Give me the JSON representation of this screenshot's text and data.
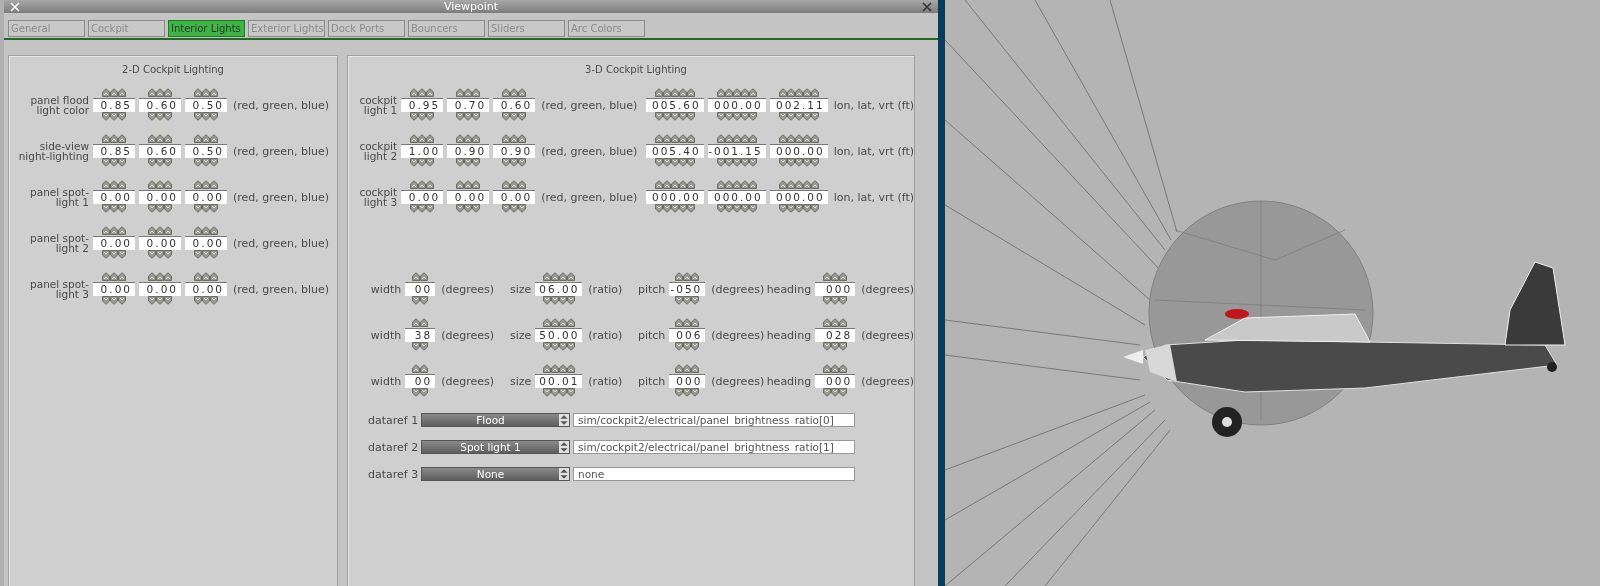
{
  "window": {
    "title": "Viewpoint"
  },
  "tabs": [
    {
      "label": "General",
      "selected": false
    },
    {
      "label": "Cockpit",
      "selected": false
    },
    {
      "label": "Interior Lights",
      "selected": true
    },
    {
      "label": "Exterior Lights",
      "selected": false
    },
    {
      "label": "Dock Ports",
      "selected": false
    },
    {
      "label": "Bouncers",
      "selected": false
    },
    {
      "label": "Sliders",
      "selected": false
    },
    {
      "label": "Arc Colors",
      "selected": false
    }
  ],
  "panel_2d": {
    "title": "2-D Cockpit Lighting",
    "rows": [
      {
        "label": "panel flood\nlight color",
        "values": [
          "0.85",
          "0.60",
          "0.50"
        ],
        "unit": "(red, green, blue)"
      },
      {
        "label": "side-view\nnight-lighting",
        "values": [
          "0.85",
          "0.60",
          "0.50"
        ],
        "unit": "(red, green, blue)"
      },
      {
        "label": "panel spot-\nlight 1",
        "values": [
          "0.00",
          "0.00",
          "0.00"
        ],
        "unit": "(red, green, blue)"
      },
      {
        "label": "panel spot-\nlight 2",
        "values": [
          "0.00",
          "0.00",
          "0.00"
        ],
        "unit": "(red, green, blue)"
      },
      {
        "label": "panel spot-\nlight 3",
        "values": [
          "0.00",
          "0.00",
          "0.00"
        ],
        "unit": "(red, green, blue)"
      }
    ]
  },
  "panel_3d": {
    "title": "3-D Cockpit Lighting",
    "lights": [
      {
        "label": "cockpit\nlight 1",
        "color_values": [
          "0.95",
          "0.70",
          "0.60"
        ],
        "color_unit": "(red, green, blue)",
        "position_values": [
          "005.60",
          "000.00",
          "002.11"
        ],
        "position_unit": "lon, lat, vrt (ft)"
      },
      {
        "label": "cockpit\nlight 2",
        "color_values": [
          "1.00",
          "0.90",
          "0.90"
        ],
        "color_unit": "(red, green, blue)",
        "position_values": [
          "005.40",
          "-001.15",
          "000.00"
        ],
        "position_unit": "lon, lat, vrt (ft)"
      },
      {
        "label": "cockpit\nlight 3",
        "color_values": [
          "0.00",
          "0.00",
          "0.00"
        ],
        "color_unit": "(red, green, blue)",
        "position_values": [
          "000.00",
          "000.00",
          "000.00"
        ],
        "position_unit": "lon, lat, vrt (ft)"
      }
    ],
    "beams": [
      {
        "fields": [
          {
            "label": "width",
            "value": "00",
            "unit": "(degrees)"
          },
          {
            "label": "size",
            "value": "06.00",
            "unit": "(ratio)"
          },
          {
            "label": "pitch",
            "value": "-050",
            "unit": "(degrees)"
          },
          {
            "label": "heading",
            "value": "000",
            "unit": "(degrees)"
          }
        ]
      },
      {
        "fields": [
          {
            "label": "width",
            "value": "38",
            "unit": "(degrees)"
          },
          {
            "label": "size",
            "value": "50.00",
            "unit": "(ratio)"
          },
          {
            "label": "pitch",
            "value": "006",
            "unit": "(degrees)"
          },
          {
            "label": "heading",
            "value": "028",
            "unit": "(degrees)"
          }
        ]
      },
      {
        "fields": [
          {
            "label": "width",
            "value": "00",
            "unit": "(degrees)"
          },
          {
            "label": "size",
            "value": "00.01",
            "unit": "(ratio)"
          },
          {
            "label": "pitch",
            "value": "000",
            "unit": "(degrees)"
          },
          {
            "label": "heading",
            "value": "000",
            "unit": "(degrees)"
          }
        ]
      }
    ],
    "datarefs": [
      {
        "label": "dataref 1",
        "option": "Flood",
        "path": "sim/cockpit2/electrical/panel_brightness_ratio[0]"
      },
      {
        "label": "dataref 2",
        "option": "Spot light 1",
        "path": "sim/cockpit2/electrical/panel_brightness_ratio[1]"
      },
      {
        "label": "dataref 3",
        "option": "None",
        "path": "none"
      }
    ]
  }
}
